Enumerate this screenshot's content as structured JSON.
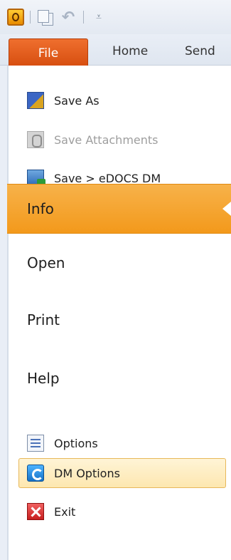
{
  "quick_access": {
    "app_icon": "outlook-icon",
    "save_icon": "save-icon",
    "undo_icon": "undo-icon",
    "customize_icon": "customize-icon",
    "customize_glyph": "⩡"
  },
  "tabs": {
    "file": "File",
    "home": "Home",
    "send": "Send"
  },
  "menu": {
    "commands_top": [
      {
        "label": "Save As",
        "icon": "save-as-icon",
        "enabled": true
      },
      {
        "label": "Save Attachments",
        "icon": "save-attachments-icon",
        "enabled": false
      },
      {
        "label": "Save > eDOCS DM",
        "icon": "save-edocs-icon",
        "enabled": true
      }
    ],
    "selected_nav": "Info",
    "nav": [
      "Open",
      "Print",
      "Help"
    ],
    "commands_bottom": [
      {
        "label": "Options",
        "icon": "options-icon"
      },
      {
        "label": "DM Options",
        "icon": "dm-options-icon"
      },
      {
        "label": "Exit",
        "icon": "exit-icon"
      }
    ]
  },
  "colors": {
    "file_tab": "#d64d0f",
    "selected_band": "#f3991b",
    "hover_highlight": "#fde7b0"
  }
}
